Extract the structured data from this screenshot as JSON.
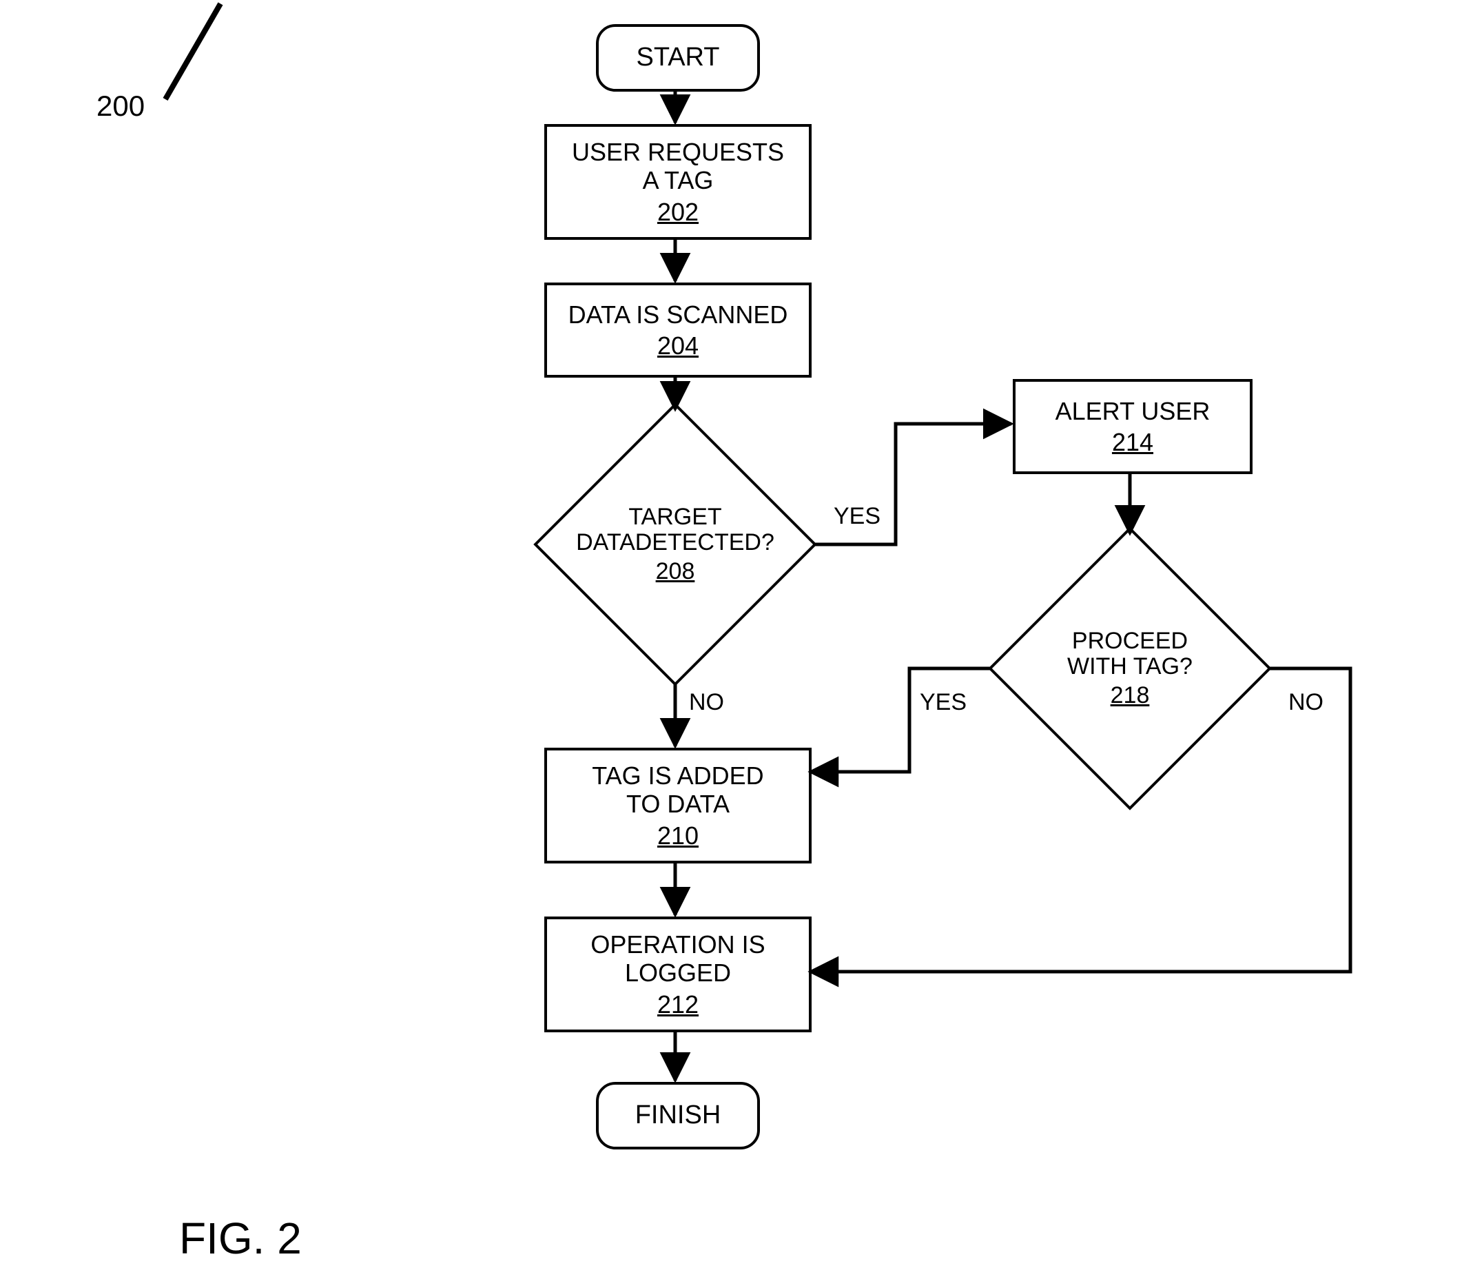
{
  "figure": {
    "ref_number": "200",
    "caption": "FIG. 2"
  },
  "nodes": {
    "start": {
      "label": "START"
    },
    "n202": {
      "line1": "USER REQUESTS",
      "line2": "A TAG",
      "ref": "202"
    },
    "n204": {
      "line1": "DATA IS SCANNED",
      "ref": "204"
    },
    "n208": {
      "line1": "TARGET",
      "line2": "DATADETECTED?",
      "ref": "208"
    },
    "n210": {
      "line1": "TAG IS ADDED",
      "line2": "TO DATA",
      "ref": "210"
    },
    "n212": {
      "line1": "OPERATION IS",
      "line2": "LOGGED",
      "ref": "212"
    },
    "n214": {
      "line1": "ALERT USER",
      "ref": "214"
    },
    "n218": {
      "line1": "PROCEED",
      "line2": "WITH TAG?",
      "ref": "218"
    },
    "finish": {
      "label": "FINISH"
    }
  },
  "edge_labels": {
    "d208_yes": "YES",
    "d208_no": "NO",
    "d218_yes": "YES",
    "d218_no": "NO"
  }
}
